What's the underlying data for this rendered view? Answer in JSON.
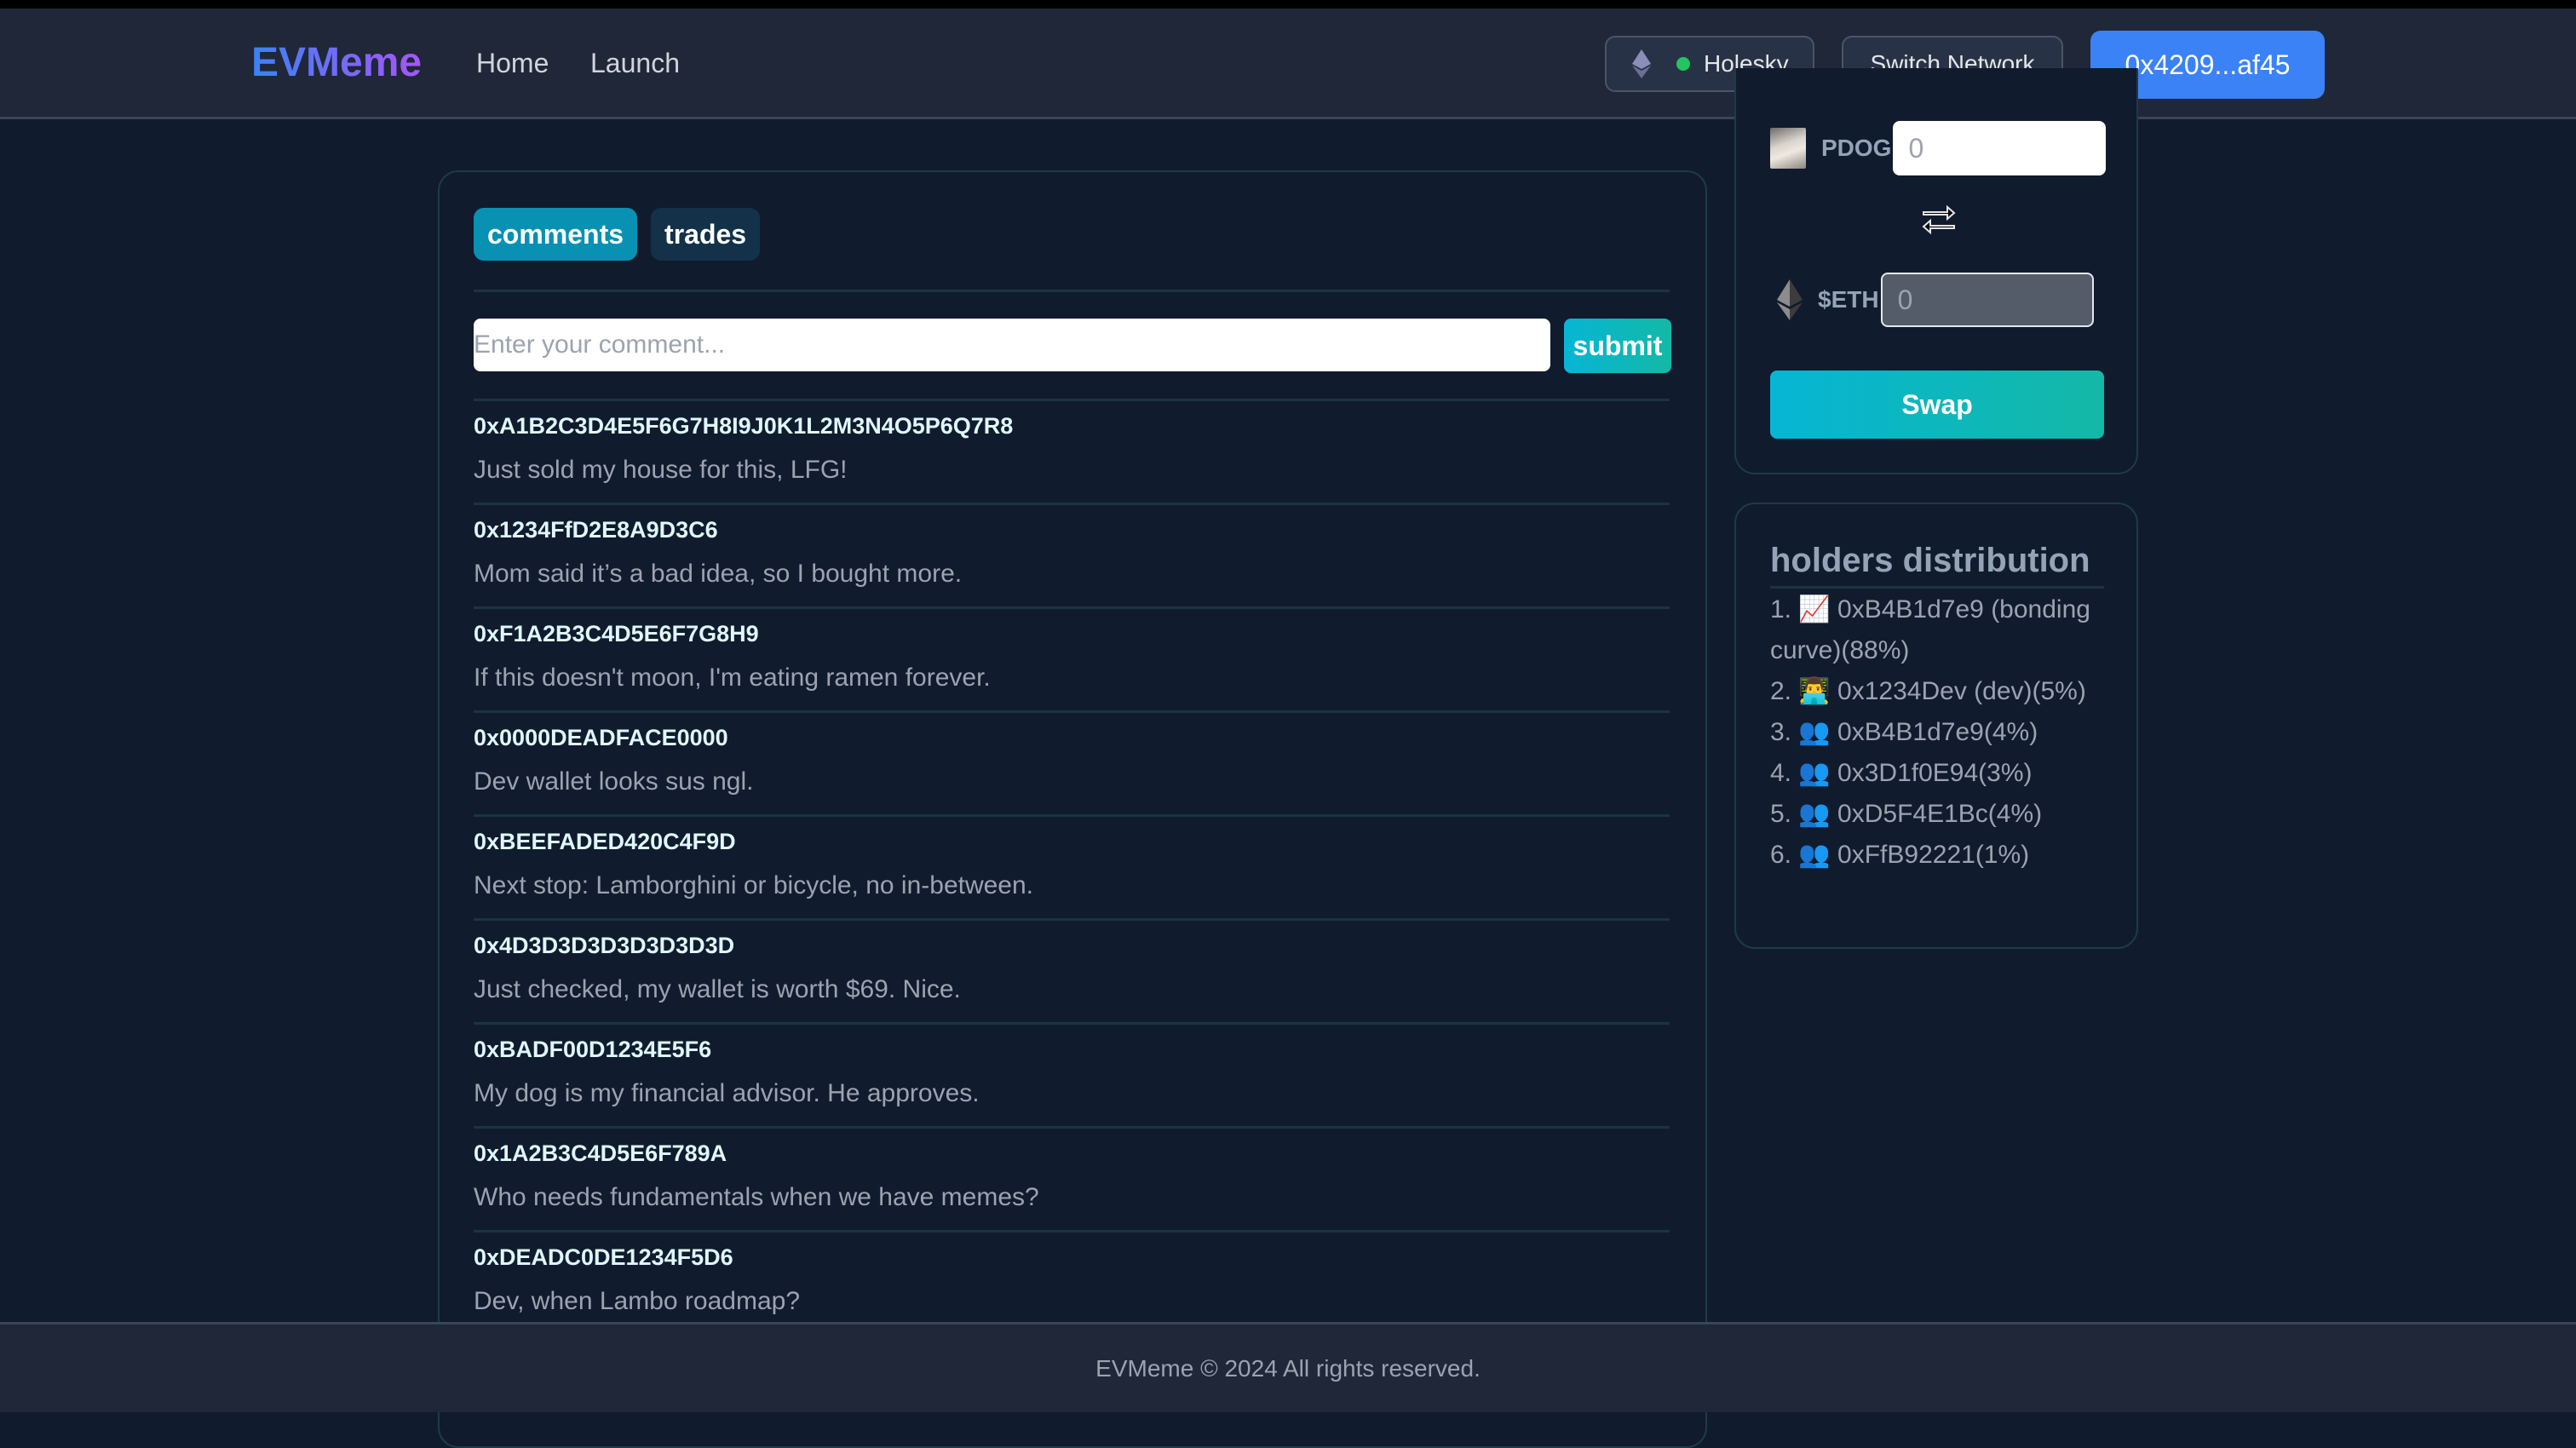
{
  "header": {
    "logo": "EVMeme",
    "nav": [
      {
        "label": "Home"
      },
      {
        "label": "Launch"
      }
    ],
    "network": {
      "name": "Holesky",
      "status_color": "#22c55e"
    },
    "switch_network_label": "Switch Network",
    "wallet_label": "0x4209...af45"
  },
  "tabs": [
    {
      "label": "comments",
      "active": true
    },
    {
      "label": "trades",
      "active": false
    }
  ],
  "comment_form": {
    "placeholder": "Enter your comment...",
    "value": "",
    "submit_label": "submit"
  },
  "comments": [
    {
      "address": "0xA1B2C3D4E5F6G7H8I9J0K1L2M3N4O5P6Q7R8",
      "text": "Just sold my house for this, LFG!"
    },
    {
      "address": "0x1234FfD2E8A9D3C6",
      "text": "Mom said it’s a bad idea, so I bought more."
    },
    {
      "address": "0xF1A2B3C4D5E6F7G8H9",
      "text": "If this doesn't moon, I'm eating ramen forever."
    },
    {
      "address": "0x0000DEADFACE0000",
      "text": "Dev wallet looks sus ngl."
    },
    {
      "address": "0xBEEFADED420C4F9D",
      "text": "Next stop: Lamborghini or bicycle, no in-between."
    },
    {
      "address": "0x4D3D3D3D3D3D3D3D",
      "text": "Just checked, my wallet is worth $69. Nice."
    },
    {
      "address": "0xBADF00D1234E5F6",
      "text": "My dog is my financial advisor. He approves."
    },
    {
      "address": "0x1A2B3C4D5E6F789A",
      "text": "Who needs fundamentals when we have memes?"
    },
    {
      "address": "0xDEADC0DE1234F5D6",
      "text": "Dev, when Lambo roadmap?"
    }
  ],
  "swap": {
    "from_token": {
      "symbol": "PDOG",
      "placeholder": "0",
      "icon": "pdog-token-image"
    },
    "to_token": {
      "symbol": "$ETH",
      "placeholder": "0",
      "icon": "ethereum-icon"
    },
    "swap_label": "Swap"
  },
  "holders": {
    "title": "holders distribution",
    "items": [
      {
        "text": "1. 📈 0xB4B1d7e9 (bonding curve)(88%)"
      },
      {
        "text": "2. 👨‍💻 0x1234Dev (dev)(5%)"
      },
      {
        "text": "3. 👥 0xB4B1d7e9(4%)"
      },
      {
        "text": "4. 👥 0x3D1f0E94(3%)"
      },
      {
        "text": "5. 👥 0xD5F4E1Bc(4%)"
      },
      {
        "text": "6. 👥 0xFfB92221(1%)"
      }
    ]
  },
  "footer": {
    "text": "EVMeme © 2024 All rights reserved."
  }
}
